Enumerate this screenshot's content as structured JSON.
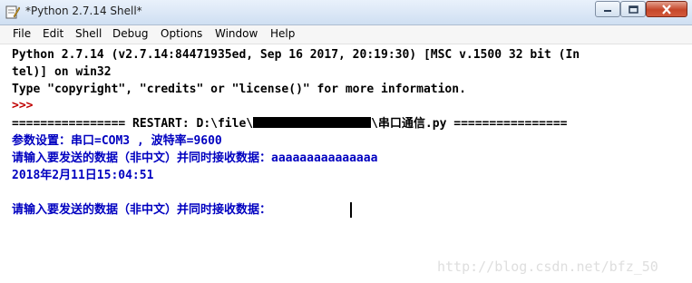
{
  "window": {
    "title": "*Python 2.7.14 Shell*",
    "buttons": {
      "minimize_icon": "minimize-icon",
      "maximize_icon": "maximize-icon",
      "close_icon": "close-icon"
    }
  },
  "menu": [
    "File",
    "Edit",
    "Shell",
    "Debug",
    "Options",
    "Window",
    "Help"
  ],
  "shell": {
    "banner1": "Python 2.7.14 (v2.7.14:84471935ed, Sep 16 2017, 20:19:30) [MSC v.1500 32 bit (In",
    "banner2": "tel)] on win32",
    "banner3": "Type \"copyright\", \"credits\" or \"license()\" for more information.",
    "prompt": ">>> ",
    "restart_prefix": "================ RESTART: D:\\file\\",
    "restart_suffix": "\\串口通信.py ================",
    "out1": "参数设置：串口=COM3 , 波特率=9600",
    "out2": "请输入要发送的数据（非中文）并同时接收数据：aaaaaaaaaaaaaaa",
    "out3": "2018年2月11日15:04:51",
    "out4": "请输入要发送的数据（非中文）并同时接收数据："
  },
  "watermark": "http://blog.csdn.net/bfz_50",
  "colors": {
    "stdout": "#0000c0",
    "prompt": "#c00000",
    "text": "#000000"
  }
}
